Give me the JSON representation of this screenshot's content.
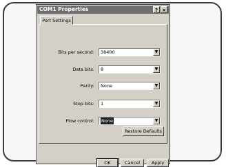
{
  "window": {
    "title": "COM1 Properties",
    "help_glyph": "?",
    "close_glyph": "×"
  },
  "tabs": [
    {
      "label": "Port Settings"
    }
  ],
  "settings": [
    {
      "label": "Bits per second:",
      "value": "38400"
    },
    {
      "label": "Data bits:",
      "value": "8"
    },
    {
      "label": "Parity:",
      "value": "None"
    },
    {
      "label": "Stop bits:",
      "value": "1"
    },
    {
      "label": "Flow control:",
      "value": "None"
    }
  ],
  "buttons": {
    "restore": "Restore Defaults",
    "ok": "OK",
    "cancel": "Cancel",
    "apply": "Apply"
  },
  "dropdown_glyph": "▼"
}
